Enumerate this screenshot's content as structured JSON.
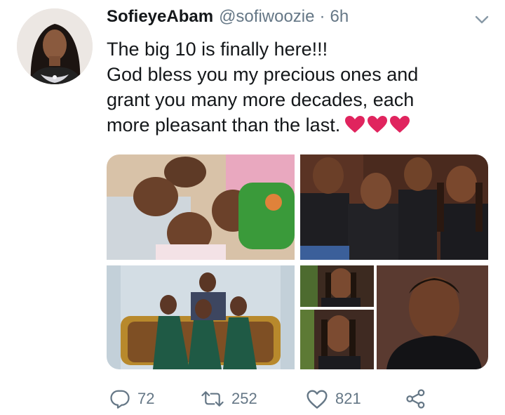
{
  "tweet": {
    "author_name": "SofieyeAbam",
    "handle": "@sofiwoozie",
    "separator": "·",
    "time": "6h",
    "text_lines": [
      "The big 10 is finally here!!!",
      "God bless you my precious ones and",
      "grant you many more decades, each",
      "more pleasant than the last."
    ],
    "emoji": "heart-emoji x3",
    "heart_color": "#e0245e"
  },
  "actions": {
    "reply_count": "72",
    "retweet_count": "252",
    "like_count": "821"
  },
  "icons": [
    "chevron-down-icon",
    "reply-icon",
    "retweet-icon",
    "like-icon",
    "share-icon"
  ],
  "colors": {
    "text": "#14171a",
    "secondary": "#657786",
    "accent_heart": "#e0245e"
  }
}
